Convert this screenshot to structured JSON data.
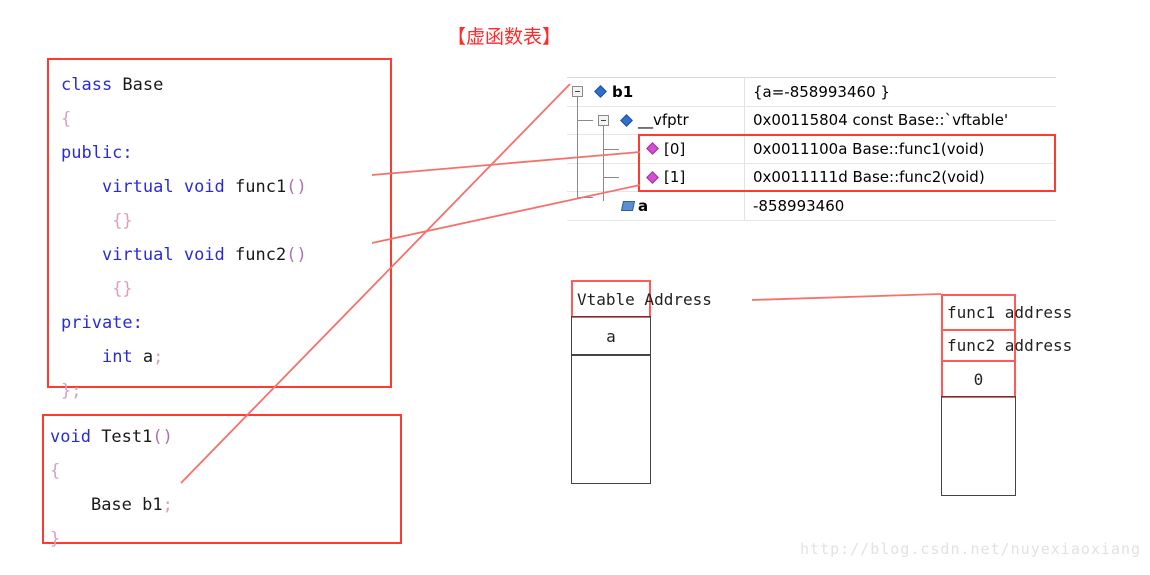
{
  "title": "【虚函数表】",
  "class_code": {
    "lines": [
      [
        {
          "t": "class ",
          "c": "kw"
        },
        {
          "t": "Base",
          "c": "id"
        }
      ],
      [
        {
          "t": "{",
          "c": "pun"
        }
      ],
      [
        {
          "t": "public",
          "c": "kw"
        },
        {
          "t": ":",
          "c": "kw"
        }
      ],
      [
        {
          "t": "    ",
          "c": "id"
        },
        {
          "t": "virtual void ",
          "c": "kw"
        },
        {
          "t": "func1",
          "c": "id"
        },
        {
          "t": "()",
          "c": "paren"
        }
      ],
      [
        {
          "t": "     ",
          "c": "id"
        },
        {
          "t": "{}",
          "c": "pun"
        }
      ],
      [
        {
          "t": "    ",
          "c": "id"
        },
        {
          "t": "virtual void ",
          "c": "kw"
        },
        {
          "t": "func2",
          "c": "id"
        },
        {
          "t": "()",
          "c": "paren"
        }
      ],
      [
        {
          "t": "     ",
          "c": "id"
        },
        {
          "t": "{}",
          "c": "pun"
        }
      ],
      [
        {
          "t": "private",
          "c": "kw"
        },
        {
          "t": ":",
          "c": "kw"
        }
      ],
      [
        {
          "t": "    ",
          "c": "id"
        },
        {
          "t": "int ",
          "c": "kw"
        },
        {
          "t": "a",
          "c": "id"
        },
        {
          "t": ";",
          "c": "pun"
        }
      ],
      [
        {
          "t": "};",
          "c": "pun"
        }
      ]
    ]
  },
  "test_code": {
    "lines": [
      [
        {
          "t": "void ",
          "c": "kw"
        },
        {
          "t": "Test1",
          "c": "id"
        },
        {
          "t": "()",
          "c": "paren"
        }
      ],
      [
        {
          "t": "{",
          "c": "pun"
        }
      ],
      [
        {
          "t": "    ",
          "c": "id"
        },
        {
          "t": "Base b1",
          "c": "id"
        },
        {
          "t": ";",
          "c": "pun"
        }
      ],
      [
        {
          "t": "}",
          "c": "pun"
        }
      ]
    ]
  },
  "watch": {
    "rows": [
      {
        "name": "b1",
        "value": "{a=-858993460 }",
        "indent": 0,
        "icon": "blue-diamond-icon",
        "expander": "collapse-box",
        "bold": true
      },
      {
        "name": "__vfptr",
        "value": "0x00115804 const Base::`vftable'",
        "indent": 1,
        "icon": "blue-diamond-icon",
        "expander": "collapse-box",
        "bold": false
      },
      {
        "name": "[0]",
        "value": "0x0011100a Base::func1(void)",
        "indent": 2,
        "icon": "purple-diamond-icon",
        "expander": "none",
        "bold": false
      },
      {
        "name": "[1]",
        "value": "0x0011111d Base::func2(void)",
        "indent": 2,
        "icon": "purple-diamond-icon",
        "expander": "none",
        "bold": false
      },
      {
        "name": "a",
        "value": "-858993460",
        "indent": 1,
        "icon": "field-icon",
        "expander": "none",
        "bold": true
      }
    ]
  },
  "object_layout": {
    "cells": [
      {
        "label": "Vtable Address",
        "style": "red",
        "overflow": true
      },
      {
        "label": "a",
        "style": "black",
        "overflow": false
      },
      {
        "label": "",
        "style": "black",
        "overflow": false
      }
    ]
  },
  "vtable_layout": {
    "cells": [
      {
        "label": "func1 address",
        "style": "red",
        "overflow": true
      },
      {
        "label": "func2 address",
        "style": "red",
        "overflow": true
      },
      {
        "label": "0",
        "style": "red",
        "overflow": false
      },
      {
        "label": "",
        "style": "black",
        "overflow": false
      }
    ]
  },
  "watermark": "http://blog.csdn.net/nuyexiaoxiang",
  "colors": {
    "annotation_red": "#ff3b30",
    "connector_red": "#f4726b",
    "keyword_blue": "#2b2bd4",
    "title_red": "#ff2a2a"
  }
}
